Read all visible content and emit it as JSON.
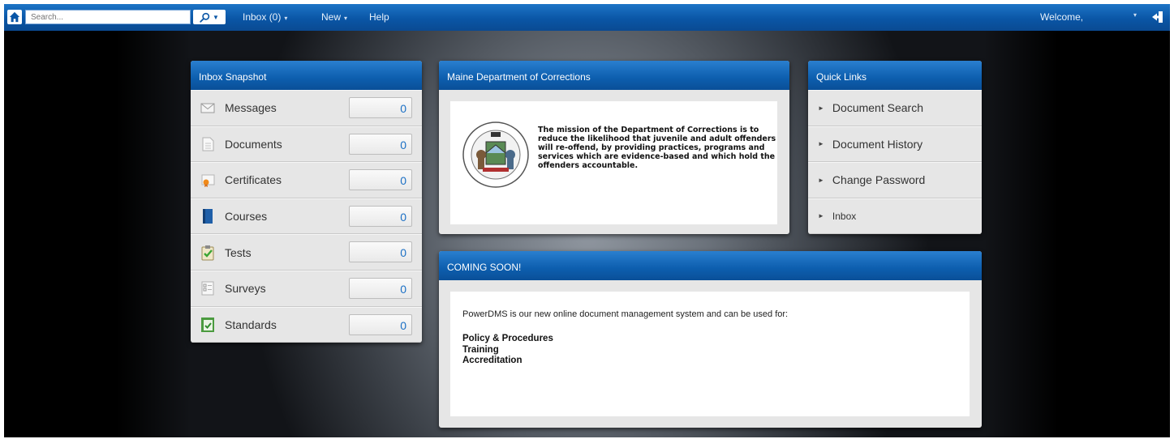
{
  "topbar": {
    "search_placeholder": "Search...",
    "nav": [
      {
        "label": "Inbox (0)",
        "has_menu": true
      },
      {
        "label": "New",
        "has_menu": true
      },
      {
        "label": "Help",
        "has_menu": false
      }
    ],
    "welcome": "Welcome,",
    "user_caret": "▾",
    "accent_color": "#0a56a6"
  },
  "inbox_snapshot": {
    "title": "Inbox Snapshot",
    "items": [
      {
        "label": "Messages",
        "count": "0",
        "icon": "envelope-icon"
      },
      {
        "label": "Documents",
        "count": "0",
        "icon": "document-icon"
      },
      {
        "label": "Certificates",
        "count": "0",
        "icon": "certificate-icon"
      },
      {
        "label": "Courses",
        "count": "0",
        "icon": "book-icon"
      },
      {
        "label": "Tests",
        "count": "0",
        "icon": "test-clipboard-icon"
      },
      {
        "label": "Surveys",
        "count": "0",
        "icon": "survey-icon"
      },
      {
        "label": "Standards",
        "count": "0",
        "icon": "standards-icon"
      }
    ]
  },
  "mission": {
    "title": "Maine Department of Corrections",
    "text": "The mission of the Department of Corrections is to reduce the likelihood that juvenile and adult offenders will re-offend, by providing practices, programs and services which are evidence-based and which hold the offenders accountable.",
    "seal_icon": "state-seal-icon"
  },
  "quick_links": {
    "title": "Quick Links",
    "items": [
      {
        "label": "Document Search"
      },
      {
        "label": "Document History"
      },
      {
        "label": "Change Password"
      },
      {
        "label": "Inbox"
      }
    ]
  },
  "coming_soon": {
    "title": "COMING SOON!",
    "intro": "PowerDMS is our new online document management system and can be used for:",
    "items": [
      "Policy & Procedures",
      "Training",
      "Accreditation"
    ]
  }
}
